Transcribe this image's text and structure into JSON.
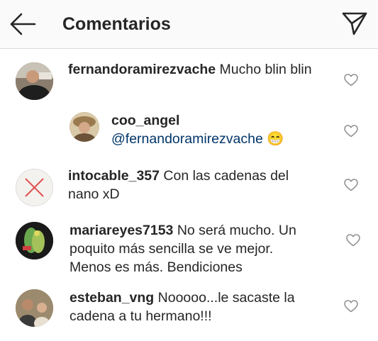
{
  "header": {
    "title": "Comentarios",
    "back_icon": "arrow-left-icon",
    "send_icon": "paper-plane-icon"
  },
  "comments": [
    {
      "username": "fernandoramirezvache",
      "text": "Mucho blin blin",
      "like_icon": "heart-outline-icon"
    },
    {
      "username": "coo_angel",
      "mention": "@fernandoramirezvache",
      "emoji": "😁",
      "like_icon": "heart-outline-icon"
    },
    {
      "username": "intocable_357",
      "text_line1": "Con las cadenas del",
      "text_line2": "nano xD",
      "like_icon": "heart-outline-icon"
    },
    {
      "username": "mariareyes7153",
      "text_line1": "No será mucho. Un",
      "text_line2": "poquito más sencilla se ve mejor.",
      "text_line3": "Menos es más. Bendiciones",
      "like_icon": "heart-outline-icon"
    },
    {
      "username": "esteban_vng",
      "text_line1": "Nooooo...le sacaste la",
      "text_line2": "cadena a tu hermano!!!",
      "like_icon": "heart-outline-icon"
    }
  ],
  "colors": {
    "text": "#262626",
    "mention": "#003569",
    "header_bg": "#fafafa",
    "divider": "#dbdbdb",
    "icon_gray": "#8e8e8e"
  }
}
